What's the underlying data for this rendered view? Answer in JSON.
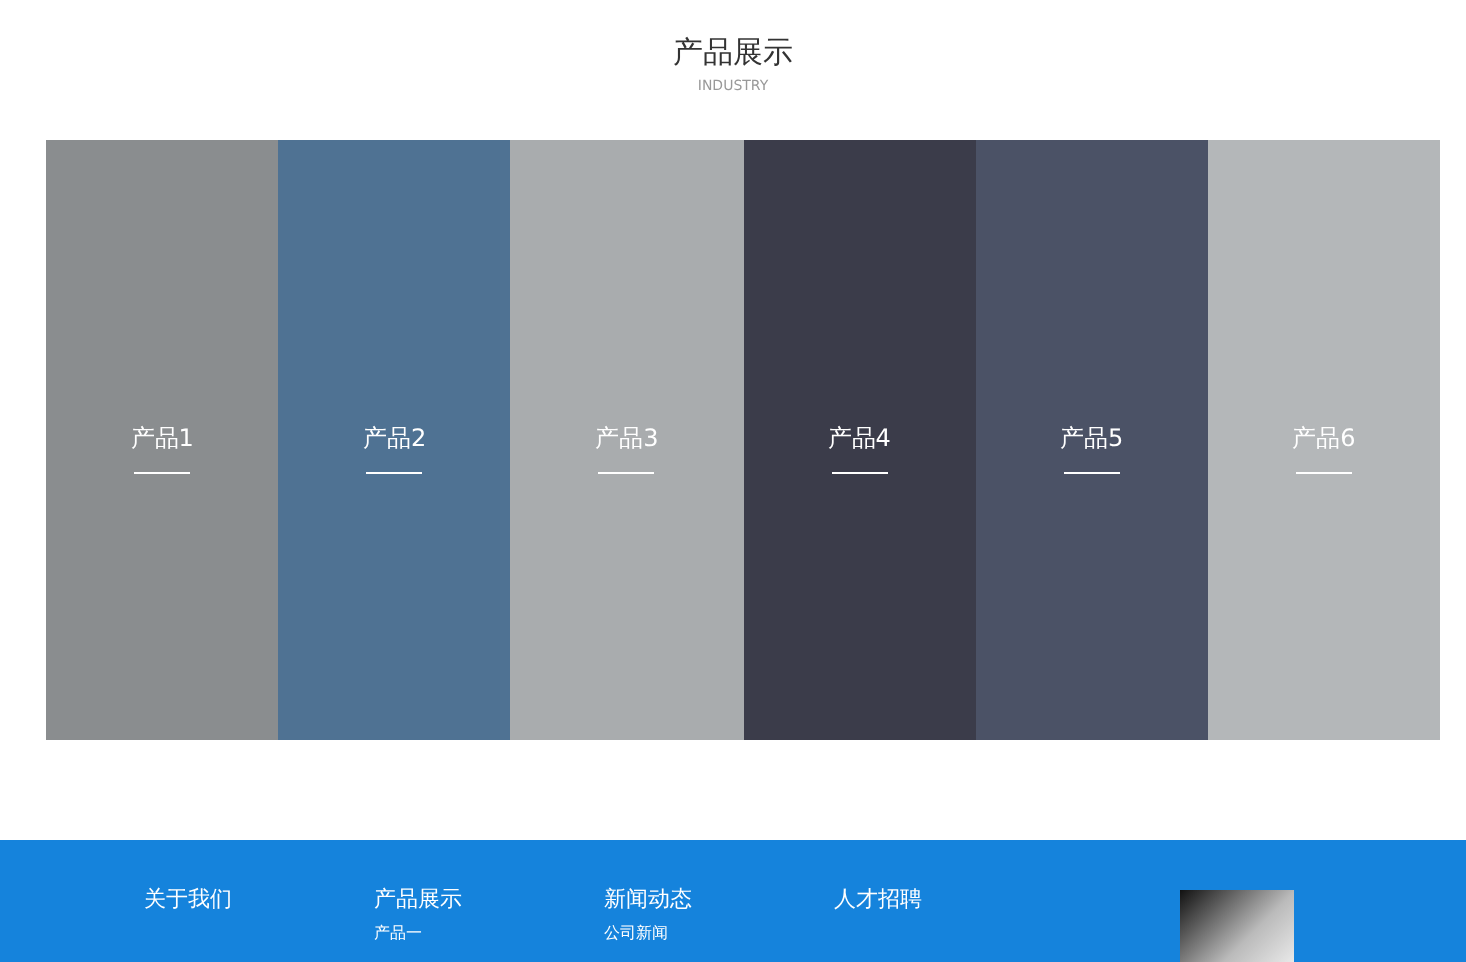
{
  "section": {
    "title": "产品展示",
    "subtitle": "INDUSTRY"
  },
  "products": [
    {
      "label": "产品1",
      "color": "#8a8d8f"
    },
    {
      "label": "产品2",
      "color": "#4f7293"
    },
    {
      "label": "产品3",
      "color": "#a9acae"
    },
    {
      "label": "产品4",
      "color": "#3b3c4a"
    },
    {
      "label": "产品5",
      "color": "#4b5266"
    },
    {
      "label": "产品6",
      "color": "#b4b7b9"
    }
  ],
  "footer": {
    "columns": [
      {
        "heading": "关于我们"
      },
      {
        "heading": "产品展示",
        "links": [
          "产品一"
        ]
      },
      {
        "heading": "新闻动态",
        "links": [
          "公司新闻"
        ]
      },
      {
        "heading": "人才招聘"
      }
    ]
  }
}
